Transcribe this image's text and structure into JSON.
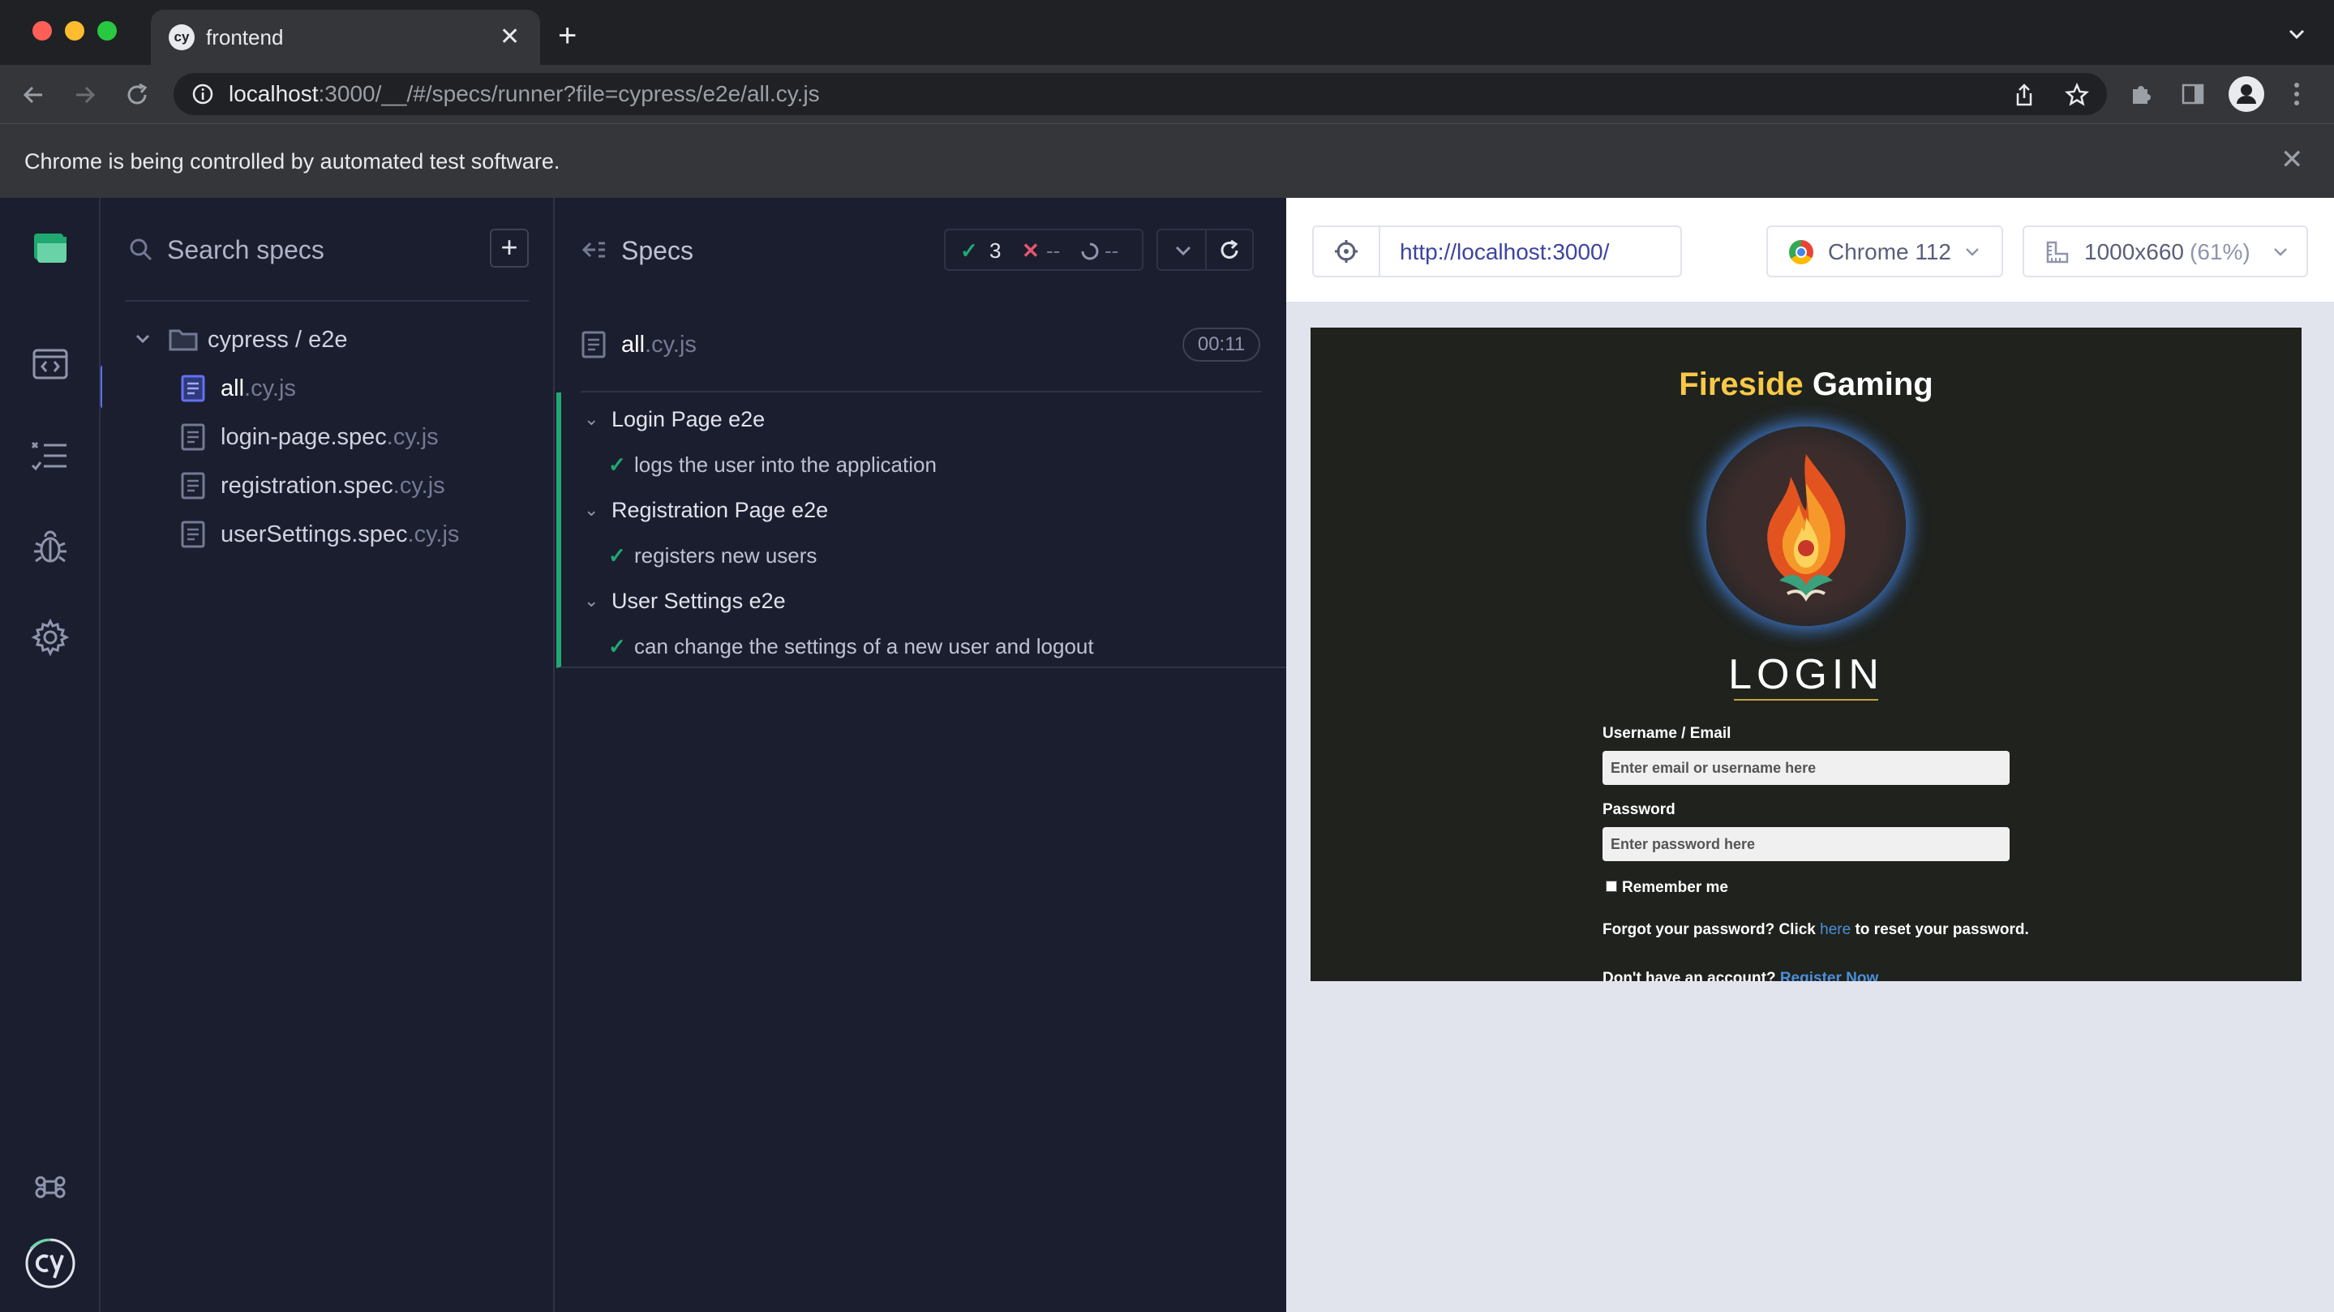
{
  "browser": {
    "tab_title": "frontend",
    "tab_favicon_text": "cy",
    "url_host": "localhost",
    "url_rest": ":3000/__/#/specs/runner?file=cypress/e2e/all.cy.js",
    "infobar_text": "Chrome is being controlled by automated test software."
  },
  "sidebar": {
    "search_placeholder": "Search specs",
    "folder": "cypress / e2e",
    "specs": [
      {
        "name": "all",
        "ext": ".cy.js",
        "active": true
      },
      {
        "name": "login-page.spec",
        "ext": ".cy.js",
        "active": false
      },
      {
        "name": "registration.spec",
        "ext": ".cy.js",
        "active": false
      },
      {
        "name": "userSettings.spec",
        "ext": ".cy.js",
        "active": false
      }
    ]
  },
  "reporter": {
    "header": "Specs",
    "passed": "3",
    "failed": "--",
    "pending": "--",
    "spec_name": "all",
    "spec_ext": ".cy.js",
    "duration": "00:11",
    "suites": [
      {
        "title": "Login Page e2e",
        "test": "logs the user into the application"
      },
      {
        "title": "Registration Page e2e",
        "test": "registers new users"
      },
      {
        "title": "User Settings e2e",
        "test": "can change the settings of a new user and logout"
      }
    ]
  },
  "aut": {
    "url": "http://localhost:3000/",
    "browser": "Chrome 112",
    "viewport": "1000x660",
    "scale": "(61%)"
  },
  "app_preview": {
    "brand_first": "Fireside",
    "brand_second": "Gaming",
    "heading": "LOGIN",
    "username_label": "Username / Email",
    "username_placeholder": "Enter email or username here",
    "password_label": "Password",
    "password_placeholder": "Enter password here",
    "remember": "Remember me",
    "forgot_prefix": "Forgot your password? Click ",
    "forgot_link": "here",
    "forgot_suffix": " to reset your password.",
    "register_prefix": "Don't have an account? ",
    "register_link": "Register Now"
  },
  "colors": {
    "accent": "#6470f3",
    "pass": "#1fa971",
    "fail": "#e45770",
    "brand_yellow": "#f7c948"
  }
}
